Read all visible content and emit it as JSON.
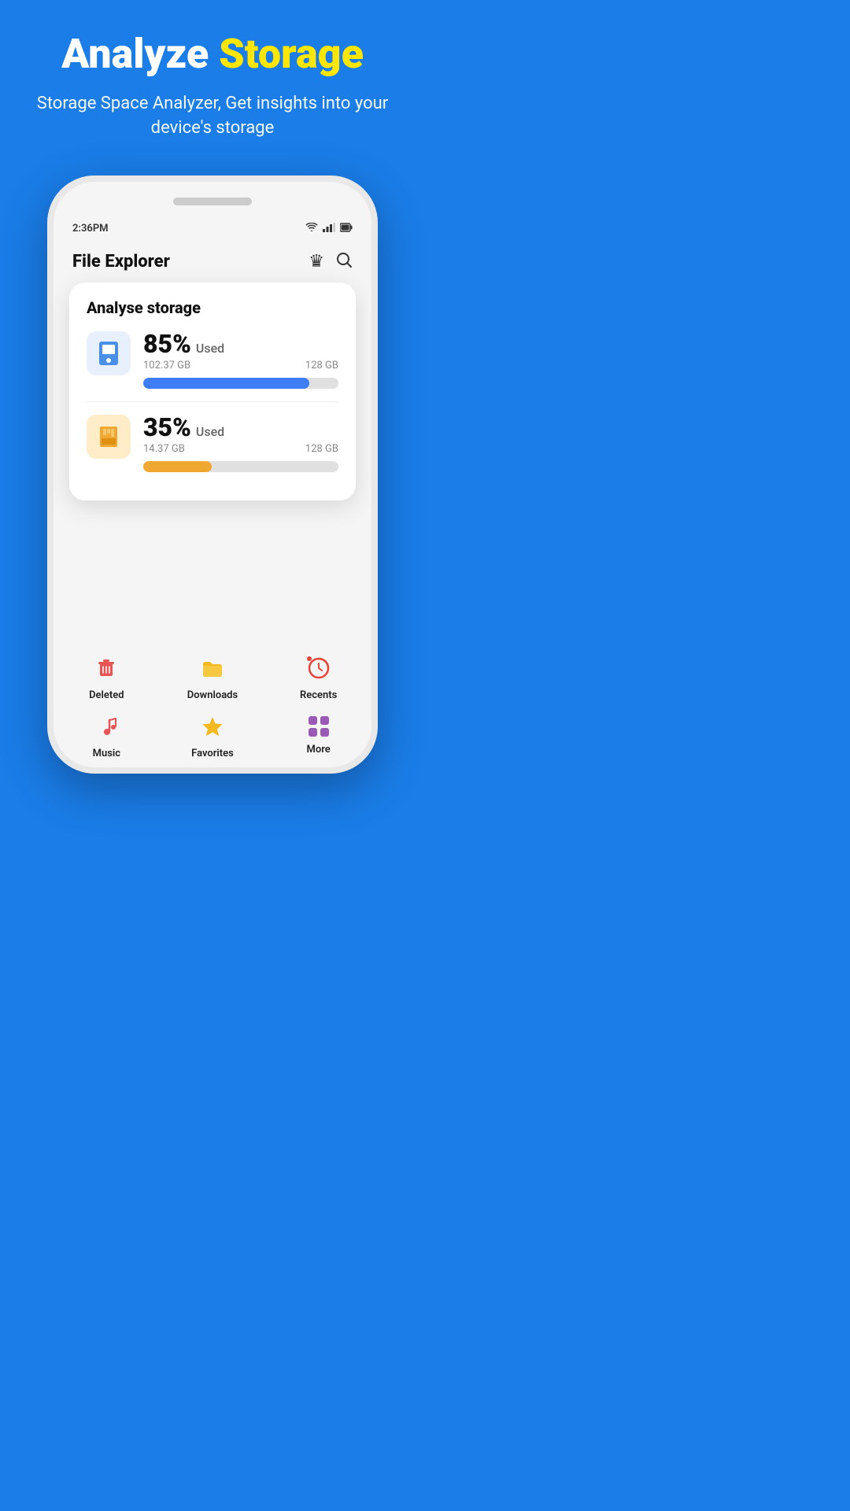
{
  "hero": {
    "title_part1": "Analyze",
    "title_part2": "Storage",
    "subtitle": "Storage Space Analyzer, Get insights into your device's storage"
  },
  "statusBar": {
    "time": "2:36PM",
    "wifi_icon": "wifi",
    "signal_icon": "signal",
    "battery_icon": "battery"
  },
  "appHeader": {
    "title": "File Explorer",
    "crown_icon": "crown",
    "search_icon": "search"
  },
  "storageCard": {
    "title": "Analyse storage",
    "internal": {
      "percent": "85%",
      "used_label": "Used",
      "used_gb": "102.37 GB",
      "total_gb": "128 GB",
      "fill_percent": 85,
      "color": "blue"
    },
    "sdcard": {
      "percent": "35%",
      "used_label": "Used",
      "used_gb": "14.37 GB",
      "total_gb": "128 GB",
      "fill_percent": 35,
      "color": "orange"
    }
  },
  "bottomNav": {
    "items": [
      {
        "id": "deleted",
        "label": "Deleted",
        "icon_type": "trash"
      },
      {
        "id": "downloads",
        "label": "Downloads",
        "icon_type": "folder"
      },
      {
        "id": "recents",
        "label": "Recents",
        "icon_type": "clock"
      },
      {
        "id": "music",
        "label": "Music",
        "icon_type": "music"
      },
      {
        "id": "favorites",
        "label": "Favorites",
        "icon_type": "star"
      },
      {
        "id": "more",
        "label": "More",
        "icon_type": "grid"
      }
    ]
  }
}
